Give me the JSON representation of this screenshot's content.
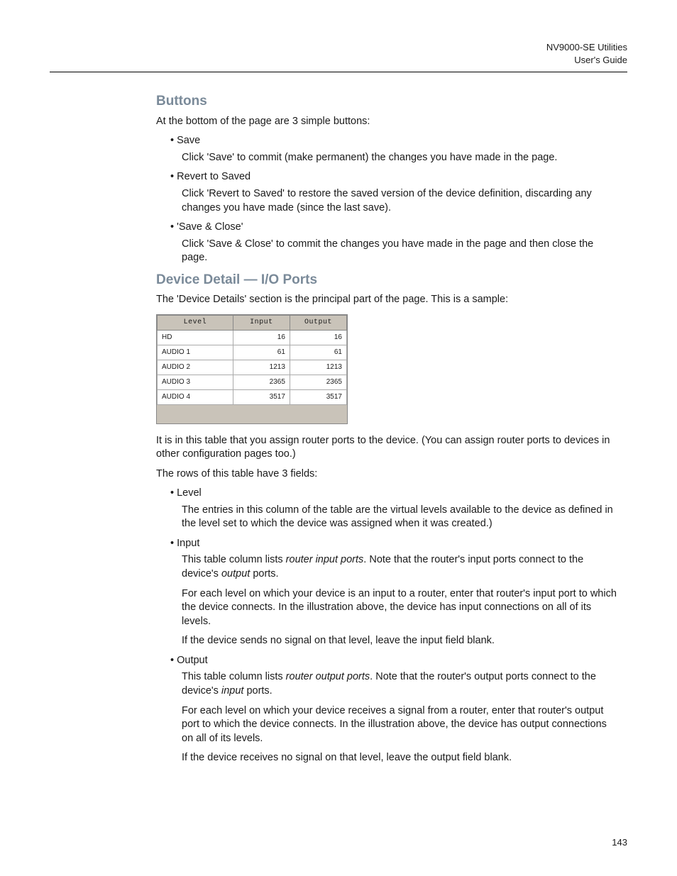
{
  "header": {
    "line1": "NV9000-SE Utilities",
    "line2": "User's Guide"
  },
  "page_number": "143",
  "sections": {
    "buttons": {
      "title": "Buttons",
      "intro": "At the bottom of the page are 3 simple buttons:",
      "items": [
        {
          "head": "Save",
          "body": "Click 'Save' to commit (make permanent) the changes you have made in the page."
        },
        {
          "head": "Revert to Saved",
          "body": "Click 'Revert to Saved' to restore the saved version of the device definition, discarding any changes you have made (since the last save)."
        },
        {
          "head": "'Save & Close'",
          "body": "Click 'Save & Close' to commit the changes you have made in the page and then close the page."
        }
      ]
    },
    "detail": {
      "title": "Device Detail — I/O Ports",
      "intro": "The 'Device Details' section is the principal part of the page. This is a sample:",
      "after_table_1": "It is in this table that you assign router ports to the device. (You can assign router ports to devices in other configuration pages too.)",
      "after_table_2": "The rows of this table have 3 fields:"
    }
  },
  "table": {
    "headers": {
      "level": "Level",
      "input": "Input",
      "output": "Output"
    },
    "rows": [
      {
        "level": "HD",
        "input": "16",
        "output": "16"
      },
      {
        "level": "AUDIO 1",
        "input": "61",
        "output": "61"
      },
      {
        "level": "AUDIO 2",
        "input": "1213",
        "output": "1213"
      },
      {
        "level": "AUDIO 3",
        "input": "2365",
        "output": "2365"
      },
      {
        "level": "AUDIO 4",
        "input": "3517",
        "output": "3517"
      }
    ]
  },
  "fields": {
    "level": {
      "head": "Level",
      "p1": "The entries in this column of the table are the virtual levels available to the device as defined in the level set to which the device was assigned when it was created.)"
    },
    "input": {
      "head": "Input",
      "p1_pre": "This table column lists ",
      "p1_em": "router input ports",
      "p1_post": ". Note that the router's input ports connect to the device's ",
      "p1_em2": "output",
      "p1_end": " ports.",
      "p2": "For each level on which your device is an input to a router, enter that router's input port to which the device connects. In the illustration above, the device has input connections on all of its levels.",
      "p3": "If the device sends no signal on that level, leave the input field blank."
    },
    "output": {
      "head": "Output",
      "p1_pre": "This table column lists ",
      "p1_em": "router output ports",
      "p1_post": ". Note that the router's output ports connect to the device's ",
      "p1_em2": "input",
      "p1_end": " ports.",
      "p2": "For each level on which your device receives a signal from a router, enter that router's output port to which the device connects. In the illustration above, the device has output connections on all of its levels.",
      "p3": "If the device receives no signal on that level, leave the output field blank."
    }
  },
  "chart_data": {
    "type": "table",
    "columns": [
      "Level",
      "Input",
      "Output"
    ],
    "rows": [
      [
        "HD",
        16,
        16
      ],
      [
        "AUDIO 1",
        61,
        61
      ],
      [
        "AUDIO 2",
        1213,
        1213
      ],
      [
        "AUDIO 3",
        2365,
        2365
      ],
      [
        "AUDIO 4",
        3517,
        3517
      ]
    ]
  }
}
